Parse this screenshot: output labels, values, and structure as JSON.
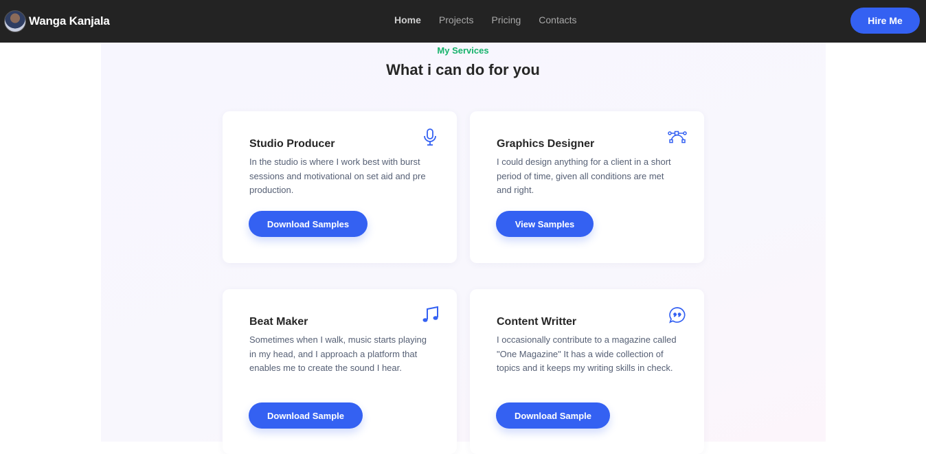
{
  "nav": {
    "brand": "Wanga Kanjala",
    "links": [
      "Home",
      "Projects",
      "Pricing",
      "Contacts"
    ],
    "active_link": "Home",
    "cta": "Hire Me"
  },
  "section": {
    "eyebrow": "My Services",
    "title": "What i can do for you"
  },
  "services": [
    {
      "title": "Studio Producer",
      "text": "In the studio is where I work best with burst sessions and motivational on set aid and pre production.",
      "button": "Download Samples",
      "icon": "microphone-icon"
    },
    {
      "title": "Graphics Designer",
      "text": "I could design anything for a client in a short period of time, given all conditions are met and right.",
      "button": "View Samples",
      "icon": "bezier-curve-icon"
    },
    {
      "title": "Beat Maker",
      "text": "Sometimes when I walk, music starts playing in my head, and I approach a platform that enables me to create the sound I hear.",
      "button": "Download Sample",
      "icon": "music-note-icon"
    },
    {
      "title": "Content Writter",
      "text": "I occasionally contribute to a magazine called \"One Magazine\" It has a wide collection of topics and it keeps my writing skills in check.",
      "button": "Download Sample",
      "icon": "quote-bubble-icon"
    }
  ],
  "colors": {
    "nav_bg": "#232323",
    "accent": "#3461f2",
    "eyebrow": "#16b26b",
    "heading": "#262626",
    "body_text": "#555f74"
  }
}
